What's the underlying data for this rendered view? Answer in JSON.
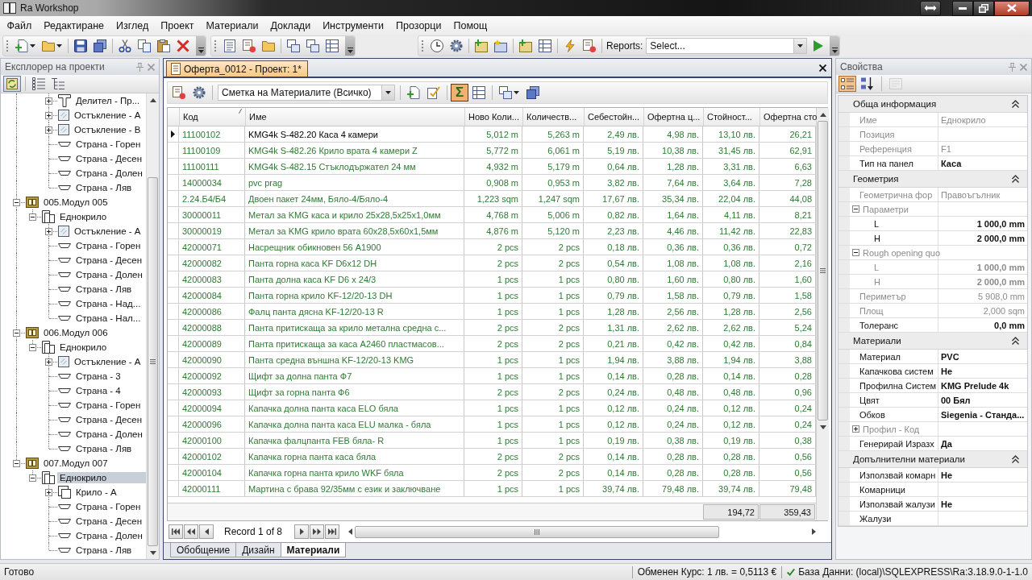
{
  "window": {
    "title": "Ra Workshop"
  },
  "menu": [
    "Файл",
    "Редактиране",
    "Изглед",
    "Проект",
    "Материали",
    "Доклади",
    "Инструменти",
    "Прозорци",
    "Помощ"
  ],
  "toolbar": {
    "reports_label": "Reports:",
    "reports_select": {
      "value": "Select..."
    }
  },
  "explorer": {
    "title": "Експлорер на проекти",
    "tools": [
      {
        "kind": "sync",
        "on": true
      },
      {
        "kind": "list",
        "on": false
      },
      {
        "kind": "tree",
        "on": false
      }
    ],
    "tree": [
      {
        "children": [
          {
            "children": [
              {
                "label": "Делител - Пр...",
                "kind": "divider",
                "expanded": false,
                "selected": false
              },
              {
                "label": "Остъкление - А",
                "kind": "glazing",
                "expanded": false,
                "selected": false
              },
              {
                "label": "Остъкление - В",
                "kind": "glazing",
                "expanded": false,
                "selected": false
              },
              {
                "label": "Страна - Горен",
                "kind": "side",
                "selected": false
              },
              {
                "label": "Страна - Десен",
                "kind": "side",
                "selected": false
              },
              {
                "label": "Страна - Долен",
                "kind": "side",
                "selected": false
              },
              {
                "label": "Страна - Ляв",
                "kind": "side",
                "selected": false
              }
            ]
          }
        ]
      },
      {
        "label": "005.Модул 005",
        "kind": "module",
        "expanded": true,
        "selected": false,
        "children": [
          {
            "label": "Еднокрило",
            "kind": "frame",
            "expanded": true,
            "selected": false,
            "children": [
              {
                "label": "Остъкление - А",
                "kind": "glazing",
                "expanded": false,
                "selected": false
              },
              {
                "label": "Страна - Горен",
                "kind": "side",
                "selected": false
              },
              {
                "label": "Страна - Десен",
                "kind": "side",
                "selected": false
              },
              {
                "label": "Страна - Долен",
                "kind": "side",
                "selected": false
              },
              {
                "label": "Страна - Ляв",
                "kind": "side",
                "selected": false
              },
              {
                "label": "Страна - Над...",
                "kind": "side",
                "selected": false
              },
              {
                "label": "Страна - Нал...",
                "kind": "side",
                "selected": false
              }
            ]
          }
        ]
      },
      {
        "label": "006.Модул 006",
        "kind": "module",
        "expanded": true,
        "selected": false,
        "children": [
          {
            "label": "Еднокрило",
            "kind": "frame",
            "expanded": true,
            "selected": false,
            "children": [
              {
                "label": "Остъкление - А",
                "kind": "glazing",
                "expanded": false,
                "selected": false
              },
              {
                "label": "Страна - 3",
                "kind": "side",
                "selected": false
              },
              {
                "label": "Страна - 4",
                "kind": "side",
                "selected": false
              },
              {
                "label": "Страна - Горен",
                "kind": "side",
                "selected": false
              },
              {
                "label": "Страна - Десен",
                "kind": "side",
                "selected": false
              },
              {
                "label": "Страна - Долен",
                "kind": "side",
                "selected": false
              },
              {
                "label": "Страна - Ляв",
                "kind": "side",
                "selected": false
              }
            ]
          }
        ]
      },
      {
        "label": "007.Модул 007",
        "kind": "module",
        "expanded": true,
        "selected": false,
        "children": [
          {
            "label": "Еднокрило",
            "kind": "frame",
            "expanded": true,
            "selected": true,
            "children": [
              {
                "label": "Крило - А",
                "kind": "sash",
                "expanded": false,
                "selected": false
              },
              {
                "label": "Страна - Горен",
                "kind": "side",
                "selected": false
              },
              {
                "label": "Страна - Десен",
                "kind": "side",
                "selected": false
              },
              {
                "label": "Страна - Долен",
                "kind": "side",
                "selected": false
              },
              {
                "label": "Страна - Ляв",
                "kind": "side",
                "selected": false
              }
            ]
          }
        ]
      }
    ]
  },
  "document": {
    "tab": {
      "title": "Оферта_0012 - Проект: 1*"
    },
    "view_select": {
      "value": "Сметка на Материалите (Всичко)"
    },
    "sum_button": {
      "label": "Σ",
      "on": true
    },
    "table": {
      "columns": [
        {
          "label": "Код",
          "sorted": true
        },
        {
          "label": "Име",
          "sorted": false
        },
        {
          "label": "Ново Коли...",
          "sorted": false
        },
        {
          "label": "Количеств...",
          "sorted": false
        },
        {
          "label": "Себестойн...",
          "sorted": false
        },
        {
          "label": "Офертна ц...",
          "sorted": false
        },
        {
          "label": "Стойност...",
          "sorted": false,
          "total": "194,72"
        },
        {
          "label": "Офертна сто",
          "sorted": false,
          "total": "359,43"
        }
      ],
      "rows": [
        {
          "selected": true,
          "cells": [
            "11100102",
            "KMG4k S-482.20 Каса 4 камери",
            "5,012 m",
            "5,263 m",
            "2,49 лв.",
            "4,98 лв.",
            "13,10 лв.",
            "26,21"
          ]
        },
        {
          "selected": false,
          "cells": [
            "11100109",
            "KMG4k S-482.26 Крило врата 4 камери Z",
            "5,772 m",
            "6,061 m",
            "5,19 лв.",
            "10,38 лв.",
            "31,45 лв.",
            "62,91"
          ]
        },
        {
          "selected": false,
          "cells": [
            "11100111",
            "KMG4k S-482.15 Стъклодържател 24 мм",
            "4,932 m",
            "5,179 m",
            "0,64 лв.",
            "1,28 лв.",
            "3,31 лв.",
            "6,63"
          ]
        },
        {
          "selected": false,
          "cells": [
            "14000034",
            "pvc prag",
            "0,908 m",
            "0,953 m",
            "3,82 лв.",
            "7,64 лв.",
            "3,64 лв.",
            "7,28"
          ]
        },
        {
          "selected": false,
          "cells": [
            "2.24.Б4/Б4",
            "Двоен пакет 24мм, Бяло-4/Бяло-4",
            "1,223 sqm",
            "1,247 sqm",
            "17,67 лв.",
            "35,34 лв.",
            "22,04 лв.",
            "44,08"
          ]
        },
        {
          "selected": false,
          "cells": [
            "30000011",
            "Метал за KMG каса и крило 25x28,5x25x1,0мм",
            "4,768 m",
            "5,006 m",
            "0,82 лв.",
            "1,64 лв.",
            "4,11 лв.",
            "8,21"
          ]
        },
        {
          "selected": false,
          "cells": [
            "30000019",
            "Метал за KMG крило врата 60x28,5x60x1,5мм",
            "4,876 m",
            "5,120 m",
            "2,23 лв.",
            "4,46 лв.",
            "11,42 лв.",
            "22,83"
          ]
        },
        {
          "selected": false,
          "cells": [
            "42000071",
            "Насрещник обикновен 56 A1900",
            "2 pcs",
            "2 pcs",
            "0,18 лв.",
            "0,36 лв.",
            "0,36 лв.",
            "0,72"
          ]
        },
        {
          "selected": false,
          "cells": [
            "42000082",
            "Панта горна каса KF D6x12 DH",
            "2 pcs",
            "2 pcs",
            "0,54 лв.",
            "1,08 лв.",
            "1,08 лв.",
            "2,16"
          ]
        },
        {
          "selected": false,
          "cells": [
            "42000083",
            "Панта долна каса KF D6 x 24/3",
            "1 pcs",
            "1 pcs",
            "0,80 лв.",
            "1,60 лв.",
            "0,80 лв.",
            "1,60"
          ]
        },
        {
          "selected": false,
          "cells": [
            "42000084",
            "Панта горна крило KF-12/20-13 DH",
            "1 pcs",
            "1 pcs",
            "0,79 лв.",
            "1,58 лв.",
            "0,79 лв.",
            "1,58"
          ]
        },
        {
          "selected": false,
          "cells": [
            "42000086",
            "Фалц панта дясна KF-12/20-13 R",
            "1 pcs",
            "1 pcs",
            "1,28 лв.",
            "2,56 лв.",
            "1,28 лв.",
            "2,56"
          ]
        },
        {
          "selected": false,
          "cells": [
            "42000088",
            "Панта притискаща за крило метална средна с...",
            "2 pcs",
            "2 pcs",
            "1,31 лв.",
            "2,62 лв.",
            "2,62 лв.",
            "5,24"
          ]
        },
        {
          "selected": false,
          "cells": [
            "42000089",
            "Панта притискаща за каса A2460 пластмасов...",
            "2 pcs",
            "2 pcs",
            "0,21 лв.",
            "0,42 лв.",
            "0,42 лв.",
            "0,84"
          ]
        },
        {
          "selected": false,
          "cells": [
            "42000090",
            "Панта средна външна KF-12/20-13 KMG",
            "1 pcs",
            "1 pcs",
            "1,94 лв.",
            "3,88 лв.",
            "1,94 лв.",
            "3,88"
          ]
        },
        {
          "selected": false,
          "cells": [
            "42000092",
            "Щифт за долна панта Ф7",
            "1 pcs",
            "1 pcs",
            "0,14 лв.",
            "0,28 лв.",
            "0,14 лв.",
            "0,28"
          ]
        },
        {
          "selected": false,
          "cells": [
            "42000093",
            "Щифт за горна панта Ф6",
            "2 pcs",
            "2 pcs",
            "0,24 лв.",
            "0,48 лв.",
            "0,48 лв.",
            "0,96"
          ]
        },
        {
          "selected": false,
          "cells": [
            "42000094",
            "Капачка долна панта каса ELO бяла",
            "1 pcs",
            "1 pcs",
            "0,12 лв.",
            "0,24 лв.",
            "0,12 лв.",
            "0,24"
          ]
        },
        {
          "selected": false,
          "cells": [
            "42000096",
            "Капачка долна панта каса ELU малка - бяла",
            "1 pcs",
            "1 pcs",
            "0,12 лв.",
            "0,24 лв.",
            "0,12 лв.",
            "0,24"
          ]
        },
        {
          "selected": false,
          "cells": [
            "42000100",
            "Капачка фалцпанта FEB бяла- R",
            "1 pcs",
            "1 pcs",
            "0,19 лв.",
            "0,38 лв.",
            "0,19 лв.",
            "0,38"
          ]
        },
        {
          "selected": false,
          "cells": [
            "42000102",
            "Капачка горна панта каса бяла",
            "2 pcs",
            "2 pcs",
            "0,14 лв.",
            "0,28 лв.",
            "0,28 лв.",
            "0,56"
          ]
        },
        {
          "selected": false,
          "cells": [
            "42000104",
            "Капачка горна панта крило WKF бяла",
            "2 pcs",
            "2 pcs",
            "0,14 лв.",
            "0,28 лв.",
            "0,28 лв.",
            "0,56"
          ]
        },
        {
          "selected": false,
          "cells": [
            "42000111",
            "Мартина с брава 92/35мм с език и заключване",
            "1 pcs",
            "1 pcs",
            "39,74 лв.",
            "79,48 лв.",
            "39,74 лв.",
            "79,48"
          ]
        }
      ]
    },
    "navigator": {
      "record": "Record 1 of 8"
    },
    "tabs": [
      {
        "label": "Обобщение",
        "selected": false
      },
      {
        "label": "Дизайн",
        "selected": false
      },
      {
        "label": "Материали",
        "selected": true
      }
    ]
  },
  "properties": {
    "title": "Свойства",
    "view_buttons": [
      {
        "kind": "categorized",
        "selected": true,
        "disabled": false
      },
      {
        "kind": "alphabetical",
        "selected": false,
        "disabled": false
      },
      {
        "kind": "pages",
        "selected": false,
        "disabled": true
      }
    ],
    "categories": [
      {
        "title": "Обща информация",
        "expanded": true,
        "items": [
          {
            "name": "Име",
            "value": "Еднокрило",
            "kind": "text",
            "readonly": true,
            "modified": false
          },
          {
            "name": "Позиция",
            "kind": "text",
            "readonly": true
          },
          {
            "name": "Референция",
            "value": "F1",
            "kind": "text",
            "readonly": true,
            "modified": false
          },
          {
            "name": "Тип на панел",
            "value": "Каса",
            "kind": "text",
            "readonly": false,
            "modified": true
          }
        ]
      },
      {
        "title": "Геометрия",
        "expanded": true,
        "items": [
          {
            "name": "Геометрична фор",
            "value": "Правоъгълник",
            "kind": "text",
            "readonly": true,
            "modified": false
          },
          {
            "name": "Параметри",
            "kind": "group",
            "readonly": true,
            "expanded": true,
            "children": [
              {
                "name": "L",
                "value": "1 000,0 mm",
                "kind": "measure",
                "readonly": false,
                "modified": true
              },
              {
                "name": "H",
                "value": "2 000,0 mm",
                "kind": "measure",
                "readonly": false,
                "modified": true
              }
            ]
          },
          {
            "name": "Rough opening quo",
            "kind": "group",
            "readonly": true,
            "expanded": true,
            "children": [
              {
                "name": "L",
                "value": "1 000,0 mm",
                "kind": "measure",
                "readonly": true,
                "modified": true
              },
              {
                "name": "H",
                "value": "2 000,0 mm",
                "kind": "measure",
                "readonly": true,
                "modified": true
              }
            ]
          },
          {
            "name": "Периметър",
            "value": "5 908,0 mm",
            "kind": "measure",
            "readonly": true,
            "modified": false
          },
          {
            "name": "Площ",
            "value": "2,000 sqm",
            "kind": "measure",
            "readonly": true,
            "modified": false
          },
          {
            "name": "Толеранс",
            "value": "0,0 mm",
            "kind": "measure",
            "readonly": false,
            "modified": true
          }
        ]
      },
      {
        "title": "Материали",
        "expanded": true,
        "items": [
          {
            "name": "Материал",
            "value": "PVC",
            "kind": "text",
            "readonly": false,
            "modified": true
          },
          {
            "name": "Капачкова систем",
            "value": "Не",
            "kind": "text",
            "readonly": false,
            "modified": true
          },
          {
            "name": "Профилна Систем",
            "value": "KMG Prelude 4k",
            "kind": "text",
            "readonly": false,
            "modified": true
          },
          {
            "name": "Цвят",
            "value": "00 Бял",
            "kind": "text",
            "readonly": false,
            "modified": true
          },
          {
            "name": "Обков",
            "value": "Siegenia - Станда...",
            "kind": "text",
            "readonly": false,
            "modified": true
          },
          {
            "name": "Профил - Код",
            "kind": "group",
            "readonly": true,
            "expanded": false
          },
          {
            "name": "Генерирай Изразх",
            "value": "Да",
            "kind": "text",
            "readonly": false,
            "modified": true
          }
        ]
      },
      {
        "title": "Допълнителни материали",
        "expanded": true,
        "items": [
          {
            "name": "Използвай комарн",
            "value": "Не",
            "kind": "text",
            "readonly": false,
            "modified": true
          },
          {
            "name": "Комарници",
            "kind": "text",
            "readonly": false
          },
          {
            "name": "Използвай жалузи",
            "value": "Не",
            "kind": "text",
            "readonly": false,
            "modified": true
          },
          {
            "name": "Жалузи",
            "kind": "text",
            "readonly": false
          }
        ]
      }
    ]
  },
  "status_bar": {
    "message": "Готово",
    "exchange": "Обменен Курс: 1 лв. = 0,5113 €",
    "database": "База Данни: (local)\\SQLEXPRESS\\Ra:3.18.9.0-1-1.0"
  }
}
